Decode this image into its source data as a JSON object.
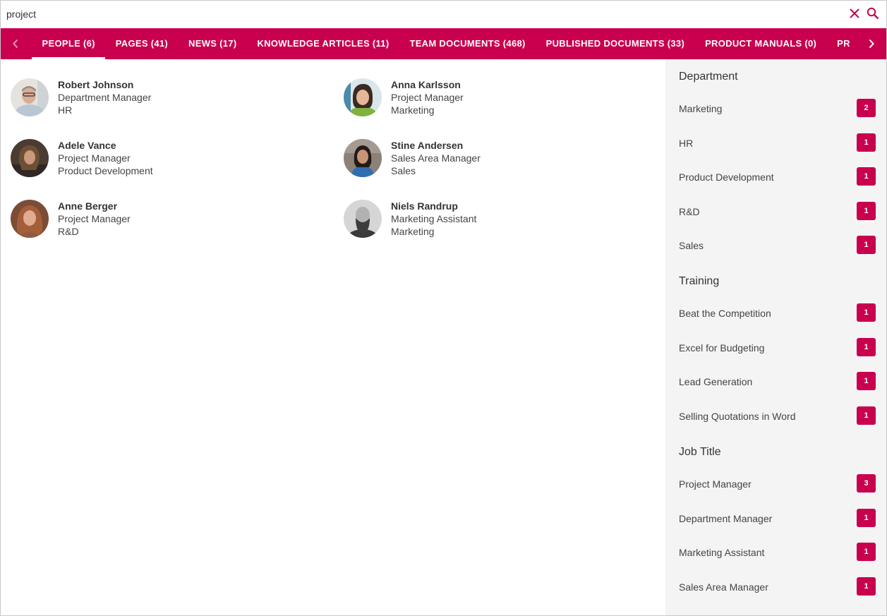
{
  "search": {
    "value": "project",
    "clear_icon": "close-icon",
    "search_icon": "search-icon"
  },
  "accent_color": "#c8004e",
  "tabs": [
    {
      "label": "PEOPLE (6)",
      "active": true
    },
    {
      "label": "PAGES (41)"
    },
    {
      "label": "NEWS (17)"
    },
    {
      "label": "KNOWLEDGE ARTICLES (11)"
    },
    {
      "label": "TEAM DOCUMENTS (468)"
    },
    {
      "label": "PUBLISHED DOCUMENTS (33)"
    },
    {
      "label": "PRODUCT MANUALS (0)"
    },
    {
      "label": "PR"
    }
  ],
  "people": [
    {
      "name": "Robert Johnson",
      "title": "Department Manager",
      "department": "HR"
    },
    {
      "name": "Anna Karlsson",
      "title": "Project Manager",
      "department": "Marketing"
    },
    {
      "name": "Adele Vance",
      "title": "Project Manager",
      "department": "Product Development"
    },
    {
      "name": "Stine Andersen",
      "title": "Sales Area Manager",
      "department": "Sales"
    },
    {
      "name": "Anne Berger",
      "title": "Project Manager",
      "department": "R&D"
    },
    {
      "name": "Niels Randrup",
      "title": "Marketing Assistant",
      "department": "Marketing"
    }
  ],
  "refiners": [
    {
      "title": "Department",
      "items": [
        {
          "label": "Marketing",
          "count": "2"
        },
        {
          "label": "HR",
          "count": "1"
        },
        {
          "label": "Product Development",
          "count": "1"
        },
        {
          "label": "R&D",
          "count": "1"
        },
        {
          "label": "Sales",
          "count": "1"
        }
      ]
    },
    {
      "title": "Training",
      "items": [
        {
          "label": "Beat the Competition",
          "count": "1"
        },
        {
          "label": "Excel for Budgeting",
          "count": "1"
        },
        {
          "label": "Lead Generation",
          "count": "1"
        },
        {
          "label": "Selling Quotations in Word",
          "count": "1"
        }
      ]
    },
    {
      "title": "Job Title",
      "items": [
        {
          "label": "Project Manager",
          "count": "3"
        },
        {
          "label": "Department Manager",
          "count": "1"
        },
        {
          "label": "Marketing Assistant",
          "count": "1"
        },
        {
          "label": "Sales Area Manager",
          "count": "1"
        }
      ]
    }
  ]
}
